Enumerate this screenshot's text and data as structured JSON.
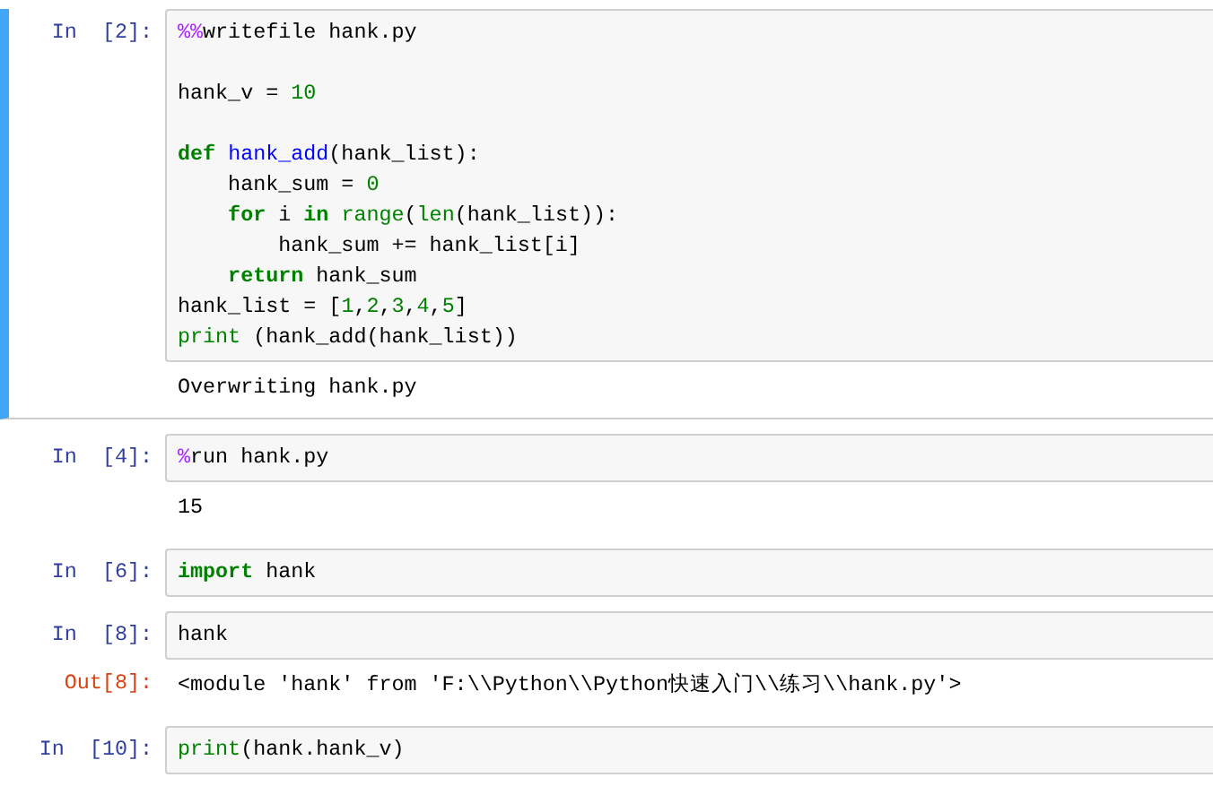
{
  "cells": [
    {
      "prompt": "In  [2]:",
      "selected": true,
      "input": [
        {
          "tokens": [
            {
              "kind": "magic",
              "text": "%%"
            },
            {
              "kind": "plain",
              "text": "writefile hank.py"
            }
          ]
        },
        {
          "spaced": true,
          "tokens": [
            {
              "kind": "plain",
              "text": "hank_v = "
            },
            {
              "kind": "num",
              "text": "10"
            }
          ]
        },
        {
          "spaced": true,
          "tokens": [
            {
              "kind": "kw",
              "text": "def "
            },
            {
              "kind": "fn",
              "text": "hank_add"
            },
            {
              "kind": "plain",
              "text": "(hank_list):"
            }
          ]
        },
        {
          "tokens": [
            {
              "kind": "plain",
              "text": "    hank_sum = "
            },
            {
              "kind": "num",
              "text": "0"
            }
          ]
        },
        {
          "tokens": [
            {
              "kind": "kw",
              "text": "    for"
            },
            {
              "kind": "plain",
              "text": " i "
            },
            {
              "kind": "kw",
              "text": "in "
            },
            {
              "kind": "builtin",
              "text": "range"
            },
            {
              "kind": "plain",
              "text": "("
            },
            {
              "kind": "builtin",
              "text": "len"
            },
            {
              "kind": "plain",
              "text": "(hank_list)):"
            }
          ]
        },
        {
          "tokens": [
            {
              "kind": "plain",
              "text": "        hank_sum += hank_list[i]"
            }
          ]
        },
        {
          "tokens": [
            {
              "kind": "kw",
              "text": "    return"
            },
            {
              "kind": "plain",
              "text": " hank_sum"
            }
          ]
        },
        {
          "tokens": [
            {
              "kind": "plain",
              "text": "hank_list = ["
            },
            {
              "kind": "num",
              "text": "1"
            },
            {
              "kind": "plain",
              "text": ","
            },
            {
              "kind": "num",
              "text": "2"
            },
            {
              "kind": "plain",
              "text": ","
            },
            {
              "kind": "num",
              "text": "3"
            },
            {
              "kind": "plain",
              "text": ","
            },
            {
              "kind": "num",
              "text": "4"
            },
            {
              "kind": "plain",
              "text": ","
            },
            {
              "kind": "num",
              "text": "5"
            },
            {
              "kind": "plain",
              "text": "]"
            }
          ]
        },
        {
          "tokens": [
            {
              "kind": "builtin",
              "text": "print"
            },
            {
              "kind": "plain",
              "text": " (hank_add(hank_list))"
            }
          ]
        }
      ],
      "output": {
        "text": "Overwriting hank.py"
      }
    },
    {
      "prompt": "In  [4]:",
      "selected": false,
      "input": [
        {
          "tokens": [
            {
              "kind": "magic",
              "text": "%"
            },
            {
              "kind": "plain",
              "text": "run hank.py"
            }
          ]
        }
      ],
      "output": {
        "text": "15"
      }
    },
    {
      "prompt": "In  [6]:",
      "selected": false,
      "input": [
        {
          "tokens": [
            {
              "kind": "kw",
              "text": "import"
            },
            {
              "kind": "plain",
              "text": " hank"
            }
          ]
        }
      ]
    },
    {
      "prompt": "In  [8]:",
      "selected": false,
      "input": [
        {
          "tokens": [
            {
              "kind": "plain",
              "text": "hank"
            }
          ]
        }
      ],
      "output": {
        "prompt": "Out[8]:",
        "text": "<module 'hank' from 'F:\\\\Python\\\\Python快速入门\\\\练习\\\\hank.py'>"
      }
    },
    {
      "prompt": "In  [10]:",
      "selected": false,
      "input": [
        {
          "tokens": [
            {
              "kind": "builtin",
              "text": "print"
            },
            {
              "kind": "plain",
              "text": "(hank.hank_v)"
            }
          ]
        }
      ]
    }
  ]
}
